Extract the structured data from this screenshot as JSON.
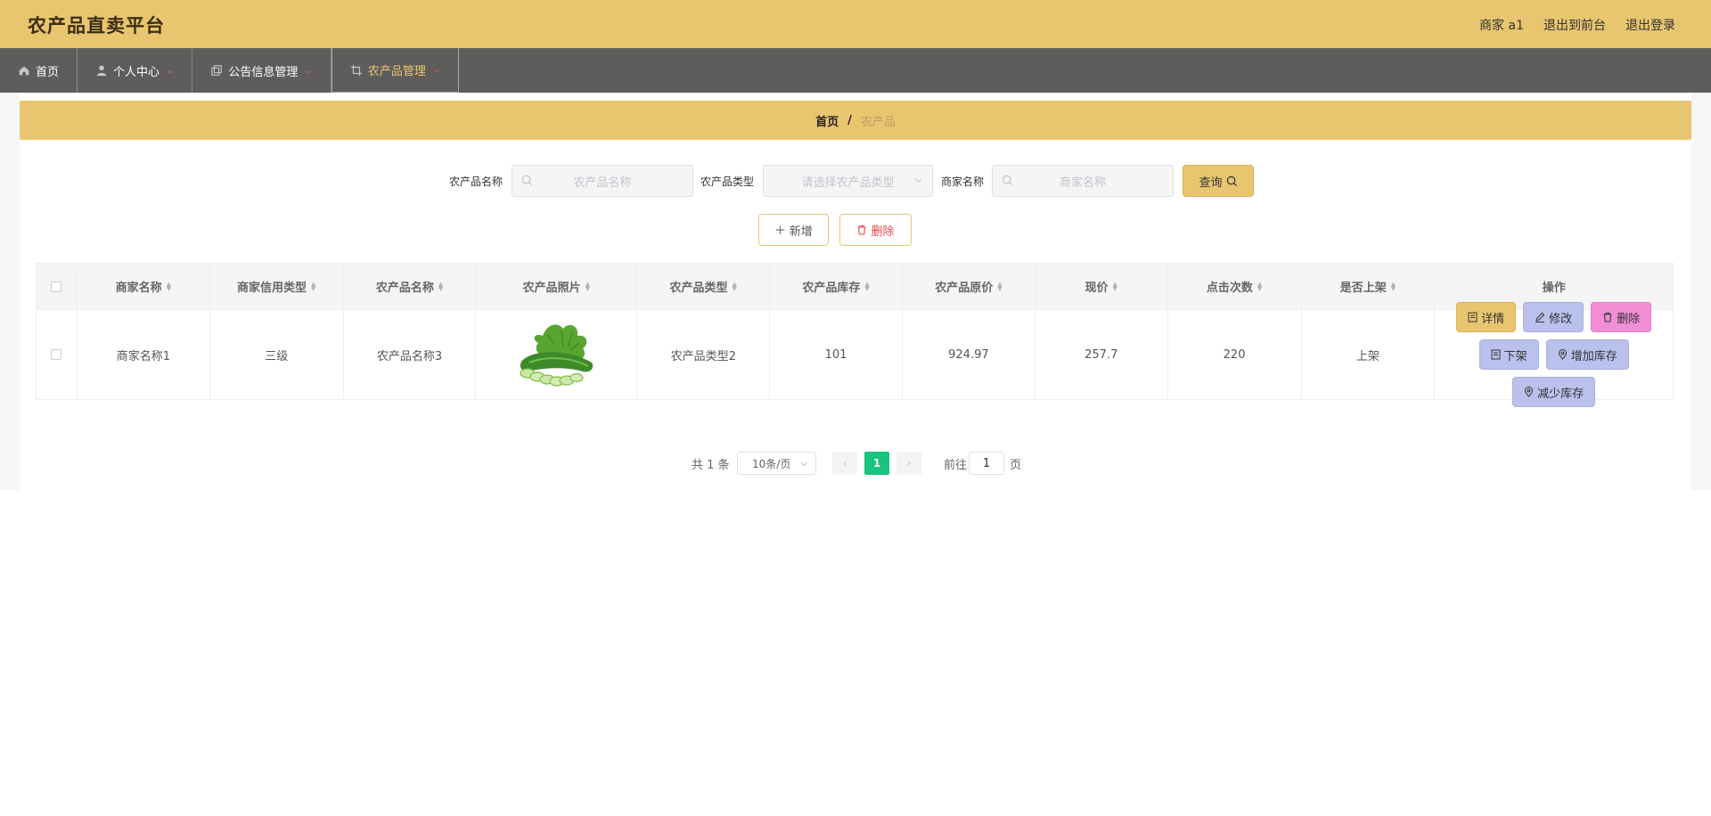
{
  "header": {
    "title": "农产品直卖平台",
    "user": "商家 a1",
    "to_front": "退出到前台",
    "logout": "退出登录"
  },
  "nav": {
    "items": [
      {
        "label": "首页",
        "icon": "home-icon"
      },
      {
        "label": "个人中心",
        "icon": "user-icon"
      },
      {
        "label": "公告信息管理",
        "icon": "copy-icon"
      },
      {
        "label": "农产品管理",
        "icon": "crop-icon"
      }
    ]
  },
  "breadcrumb": {
    "home": "首页",
    "sep": "/",
    "current": "农产品"
  },
  "search": {
    "name_label": "农产品名称",
    "name_placeholder": "农产品名称",
    "type_label": "农产品类型",
    "type_placeholder": "请选择农产品类型",
    "merchant_label": "商家名称",
    "merchant_placeholder": "商家名称",
    "query_label": "查询"
  },
  "actions": {
    "add": "新增",
    "delete": "删除"
  },
  "table": {
    "headers": [
      "商家名称",
      "商家信用类型",
      "农产品名称",
      "农产品照片",
      "农产品类型",
      "农产品库存",
      "农产品原价",
      "现价",
      "点击次数",
      "是否上架",
      "操作"
    ],
    "rows": [
      {
        "merchant": "商家名称1",
        "credit": "三级",
        "name": "农产品名称3",
        "photo": "cucumber-image",
        "type": "农产品类型2",
        "stock": "101",
        "original_price": "924.97",
        "price": "257.7",
        "clicks": "220",
        "listed": "上架"
      }
    ],
    "ops": {
      "detail": "详情",
      "edit": "修改",
      "remove": "删除",
      "off_shelf": "下架",
      "add_stock": "增加库存",
      "reduce_stock": "减少库存"
    }
  },
  "pager": {
    "total": "共 1 条",
    "size": "10条/页",
    "current": "1",
    "goto": "前往",
    "goto_value": "1",
    "page_unit": "页"
  },
  "colors": {
    "accent": "#e8c56f",
    "nav_bg": "#5f5d5c",
    "active_page": "#18c37d",
    "op_blue": "#b9c1ec",
    "op_pink": "#f28ed6",
    "danger": "#e04848"
  }
}
